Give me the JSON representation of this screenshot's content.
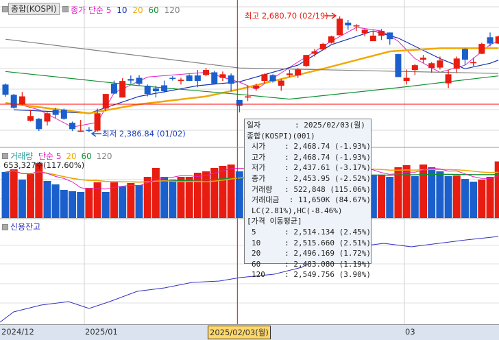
{
  "price_panel": {
    "symbol_button": "종합(KOSPI)",
    "legend_title": "종가 단순",
    "ma_labels": [
      "5",
      "10",
      "20",
      "60",
      "120"
    ],
    "ma_colors": [
      "#e020c0",
      "#1030b0",
      "#f0a800",
      "#109030",
      "#808080"
    ],
    "high_marker": "최고 2,680.70 (02/19)",
    "low_marker": "최저 2,386.84 (01/02)"
  },
  "volume_panel": {
    "title": "거래량",
    "legend_title": "단순",
    "ma_labels": [
      "5",
      "20",
      "60",
      "120"
    ],
    "current_value": "653,327주(117.60%)"
  },
  "credit_panel": {
    "title": "신용잔고"
  },
  "x_axis": {
    "labels": [
      "2024/12",
      "2025/01",
      "03"
    ],
    "selected": "2025/02/03(월)"
  },
  "colors": {
    "up": "#e81c10",
    "down": "#1a5fcc",
    "crosshair": "#ff0000"
  },
  "tooltip": {
    "rows": [
      {
        "k": "일자",
        "v": ": 2025/02/03(월)"
      },
      {
        "k": "종합(KOSPI)(001)",
        "v": ""
      },
      {
        "k": "시가",
        "v": ": 2,468.74 (-1.93%)",
        "ind": true
      },
      {
        "k": "고가",
        "v": ": 2,468.74 (-1.93%)",
        "ind": true
      },
      {
        "k": "저가",
        "v": ": 2,437.61 (-3.17%)",
        "ind": true
      },
      {
        "k": "종가",
        "v": ": 2,453.95 (-2.52%)",
        "ind": true
      },
      {
        "k": "거래량",
        "v": ": 522,848 (115.06%)",
        "ind": true
      },
      {
        "k": "거래대금",
        "v": ": 11,650K (84.67%)",
        "ind": true
      },
      {
        "k": "LC(2.81%),HC(-8.46%)",
        "v": "",
        "ind": true
      },
      {
        "k": "[가격 이동평균]",
        "v": ""
      },
      {
        "k": "5",
        "v": ": 2,514.134 (2.45%)",
        "ind": true
      },
      {
        "k": "10",
        "v": ": 2,515.660 (2.51%)",
        "ind": true
      },
      {
        "k": "20",
        "v": ": 2,496.169 (1.72%)",
        "ind": true
      },
      {
        "k": "60",
        "v": ": 2,483.080 (1.19%)",
        "ind": true
      },
      {
        "k": "120",
        "v": ": 2,549.756 (3.90%)",
        "ind": true
      }
    ]
  },
  "chart_data": {
    "type": "candlestick",
    "selected_index": 28,
    "price_range": [
      2386.84,
      2680.7
    ],
    "ohlc": [
      [
        2508,
        2511,
        2477,
        2482
      ],
      [
        2482,
        2484,
        2447,
        2449
      ],
      [
        2458,
        2489,
        2456,
        2478
      ],
      [
        2416,
        2444,
        2414,
        2428
      ],
      [
        2421,
        2423,
        2390,
        2395
      ],
      [
        2414,
        2438,
        2404,
        2435
      ],
      [
        2444,
        2449,
        2423,
        2431
      ],
      [
        2444,
        2447,
        2419,
        2421
      ],
      [
        2411,
        2414,
        2390,
        2395
      ],
      [
        2388,
        2418,
        2388,
        2391
      ],
      [
        2393,
        2400,
        2386.84,
        2391
      ],
      [
        2391,
        2447,
        2388,
        2435
      ],
      [
        2447,
        2484,
        2440,
        2484
      ],
      [
        2510,
        2518,
        2484,
        2485
      ],
      [
        2475,
        2524,
        2475,
        2517
      ],
      [
        2522,
        2531,
        2510,
        2518
      ],
      [
        2525,
        2532,
        2506,
        2510
      ],
      [
        2505,
        2508,
        2478,
        2484
      ],
      [
        2498,
        2505,
        2475,
        2491
      ],
      [
        2506,
        2518,
        2487,
        2491
      ],
      [
        2525,
        2529,
        2518,
        2524
      ],
      [
        2517,
        2525,
        2508,
        2520
      ],
      [
        2531,
        2534,
        2517,
        2517
      ],
      [
        2531,
        2545,
        2501,
        2517
      ],
      [
        2532,
        2550,
        2529,
        2545
      ],
      [
        2539,
        2543,
        2510,
        2510
      ],
      [
        2525,
        2541,
        2517,
        2534
      ],
      [
        2531,
        2536,
        2491,
        2510
      ],
      [
        2468.74,
        2468.74,
        2437.61,
        2453.95
      ],
      [
        2475,
        2505,
        2466,
        2478
      ],
      [
        2498,
        2510,
        2492,
        2505
      ],
      [
        2517,
        2536,
        2510,
        2534
      ],
      [
        2532,
        2534,
        2513,
        2517
      ],
      [
        2505,
        2522,
        2492,
        2518
      ],
      [
        2532,
        2545,
        2527,
        2536
      ],
      [
        2531,
        2550,
        2525,
        2546
      ],
      [
        2555,
        2583,
        2553,
        2583
      ],
      [
        2586,
        2598,
        2579,
        2592
      ],
      [
        2597,
        2614,
        2595,
        2611
      ],
      [
        2614,
        2632,
        2612,
        2630
      ],
      [
        2633,
        2680.7,
        2633,
        2675
      ],
      [
        2665,
        2672,
        2647,
        2658
      ],
      [
        2656,
        2661,
        2644,
        2658
      ],
      [
        2638,
        2649,
        2630,
        2647
      ],
      [
        2618,
        2644,
        2618,
        2632
      ],
      [
        2632,
        2649,
        2621,
        2644
      ],
      [
        2640,
        2640,
        2609,
        2623
      ],
      [
        2585,
        2586,
        2527,
        2527
      ],
      [
        2517,
        2546,
        2508,
        2525
      ],
      [
        2545,
        2560,
        2532,
        2557
      ],
      [
        2571,
        2583,
        2562,
        2576
      ],
      [
        2550,
        2565,
        2538,
        2562
      ],
      [
        2551,
        2579,
        2546,
        2569
      ],
      [
        2511,
        2546,
        2499,
        2534
      ],
      [
        2548,
        2579,
        2538,
        2574
      ],
      [
        2598,
        2600,
        2557,
        2571
      ],
      [
        2562,
        2576,
        2555,
        2565
      ],
      [
        2586,
        2614,
        2585,
        2611
      ],
      [
        2628,
        2640,
        2605,
        2612
      ],
      [
        2612,
        2632,
        2611,
        2630
      ]
    ],
    "price_ma": {
      "5": [
        [
          1,
          2461
        ],
        [
          4,
          2444
        ],
        [
          8,
          2400
        ],
        [
          11,
          2412
        ],
        [
          13,
          2487
        ],
        [
          17,
          2527
        ],
        [
          24,
          2539
        ],
        [
          28,
          2514
        ],
        [
          30,
          2496
        ],
        [
          35,
          2565
        ],
        [
          39,
          2618
        ],
        [
          42,
          2653
        ],
        [
          45,
          2644
        ],
        [
          47,
          2618
        ],
        [
          49,
          2574
        ],
        [
          52,
          2539
        ],
        [
          55,
          2557
        ],
        [
          58,
          2609
        ],
        [
          59,
          2618
        ]
      ],
      "10": [
        [
          1,
          2444
        ],
        [
          10,
          2435
        ],
        [
          16,
          2478
        ],
        [
          23,
          2505
        ],
        [
          28,
          2515
        ],
        [
          35,
          2557
        ],
        [
          39,
          2609
        ],
        [
          44,
          2644
        ],
        [
          47,
          2626
        ],
        [
          52,
          2574
        ],
        [
          55,
          2548
        ],
        [
          58,
          2562
        ],
        [
          59,
          2570
        ]
      ],
      "20": [
        [
          0,
          2461
        ],
        [
          10,
          2435
        ],
        [
          16,
          2458
        ],
        [
          24,
          2478
        ],
        [
          28,
          2496
        ],
        [
          38,
          2548
        ],
        [
          46,
          2592
        ],
        [
          52,
          2600
        ],
        [
          59,
          2600
        ]
      ],
      "60": [
        [
          0,
          2541
        ],
        [
          16,
          2505
        ],
        [
          28,
          2483
        ],
        [
          34,
          2471
        ],
        [
          47,
          2500
        ],
        [
          59,
          2530
        ]
      ],
      "120": [
        [
          0,
          2623
        ],
        [
          28,
          2550
        ],
        [
          59,
          2536
        ]
      ]
    },
    "volume_thousands": [
      531,
      562,
      444,
      507,
      634,
      428,
      388,
      325,
      309,
      301,
      348,
      412,
      301,
      412,
      364,
      404,
      380,
      475,
      578,
      475,
      444,
      475,
      475,
      523,
      539,
      578,
      602,
      618,
      539,
      522.848,
      539,
      554,
      499,
      523,
      539,
      578,
      618,
      634,
      602,
      554,
      649,
      578,
      539,
      523,
      491,
      491,
      475,
      586,
      610,
      483,
      618,
      586,
      539,
      483,
      491,
      451,
      420,
      444,
      475,
      653.327
    ],
    "credit_balance_relative": [
      [
        0,
        0
      ],
      [
        20,
        15
      ],
      [
        60,
        25
      ],
      [
        100,
        30
      ],
      [
        130,
        20
      ],
      [
        160,
        30
      ],
      [
        200,
        45
      ],
      [
        240,
        50
      ],
      [
        280,
        58
      ],
      [
        320,
        60
      ],
      [
        350,
        65
      ],
      [
        400,
        70
      ],
      [
        440,
        80
      ],
      [
        480,
        100
      ],
      [
        520,
        110
      ],
      [
        560,
        115
      ],
      [
        600,
        110
      ],
      [
        640,
        115
      ],
      [
        680,
        120
      ],
      [
        727,
        125
      ]
    ]
  }
}
